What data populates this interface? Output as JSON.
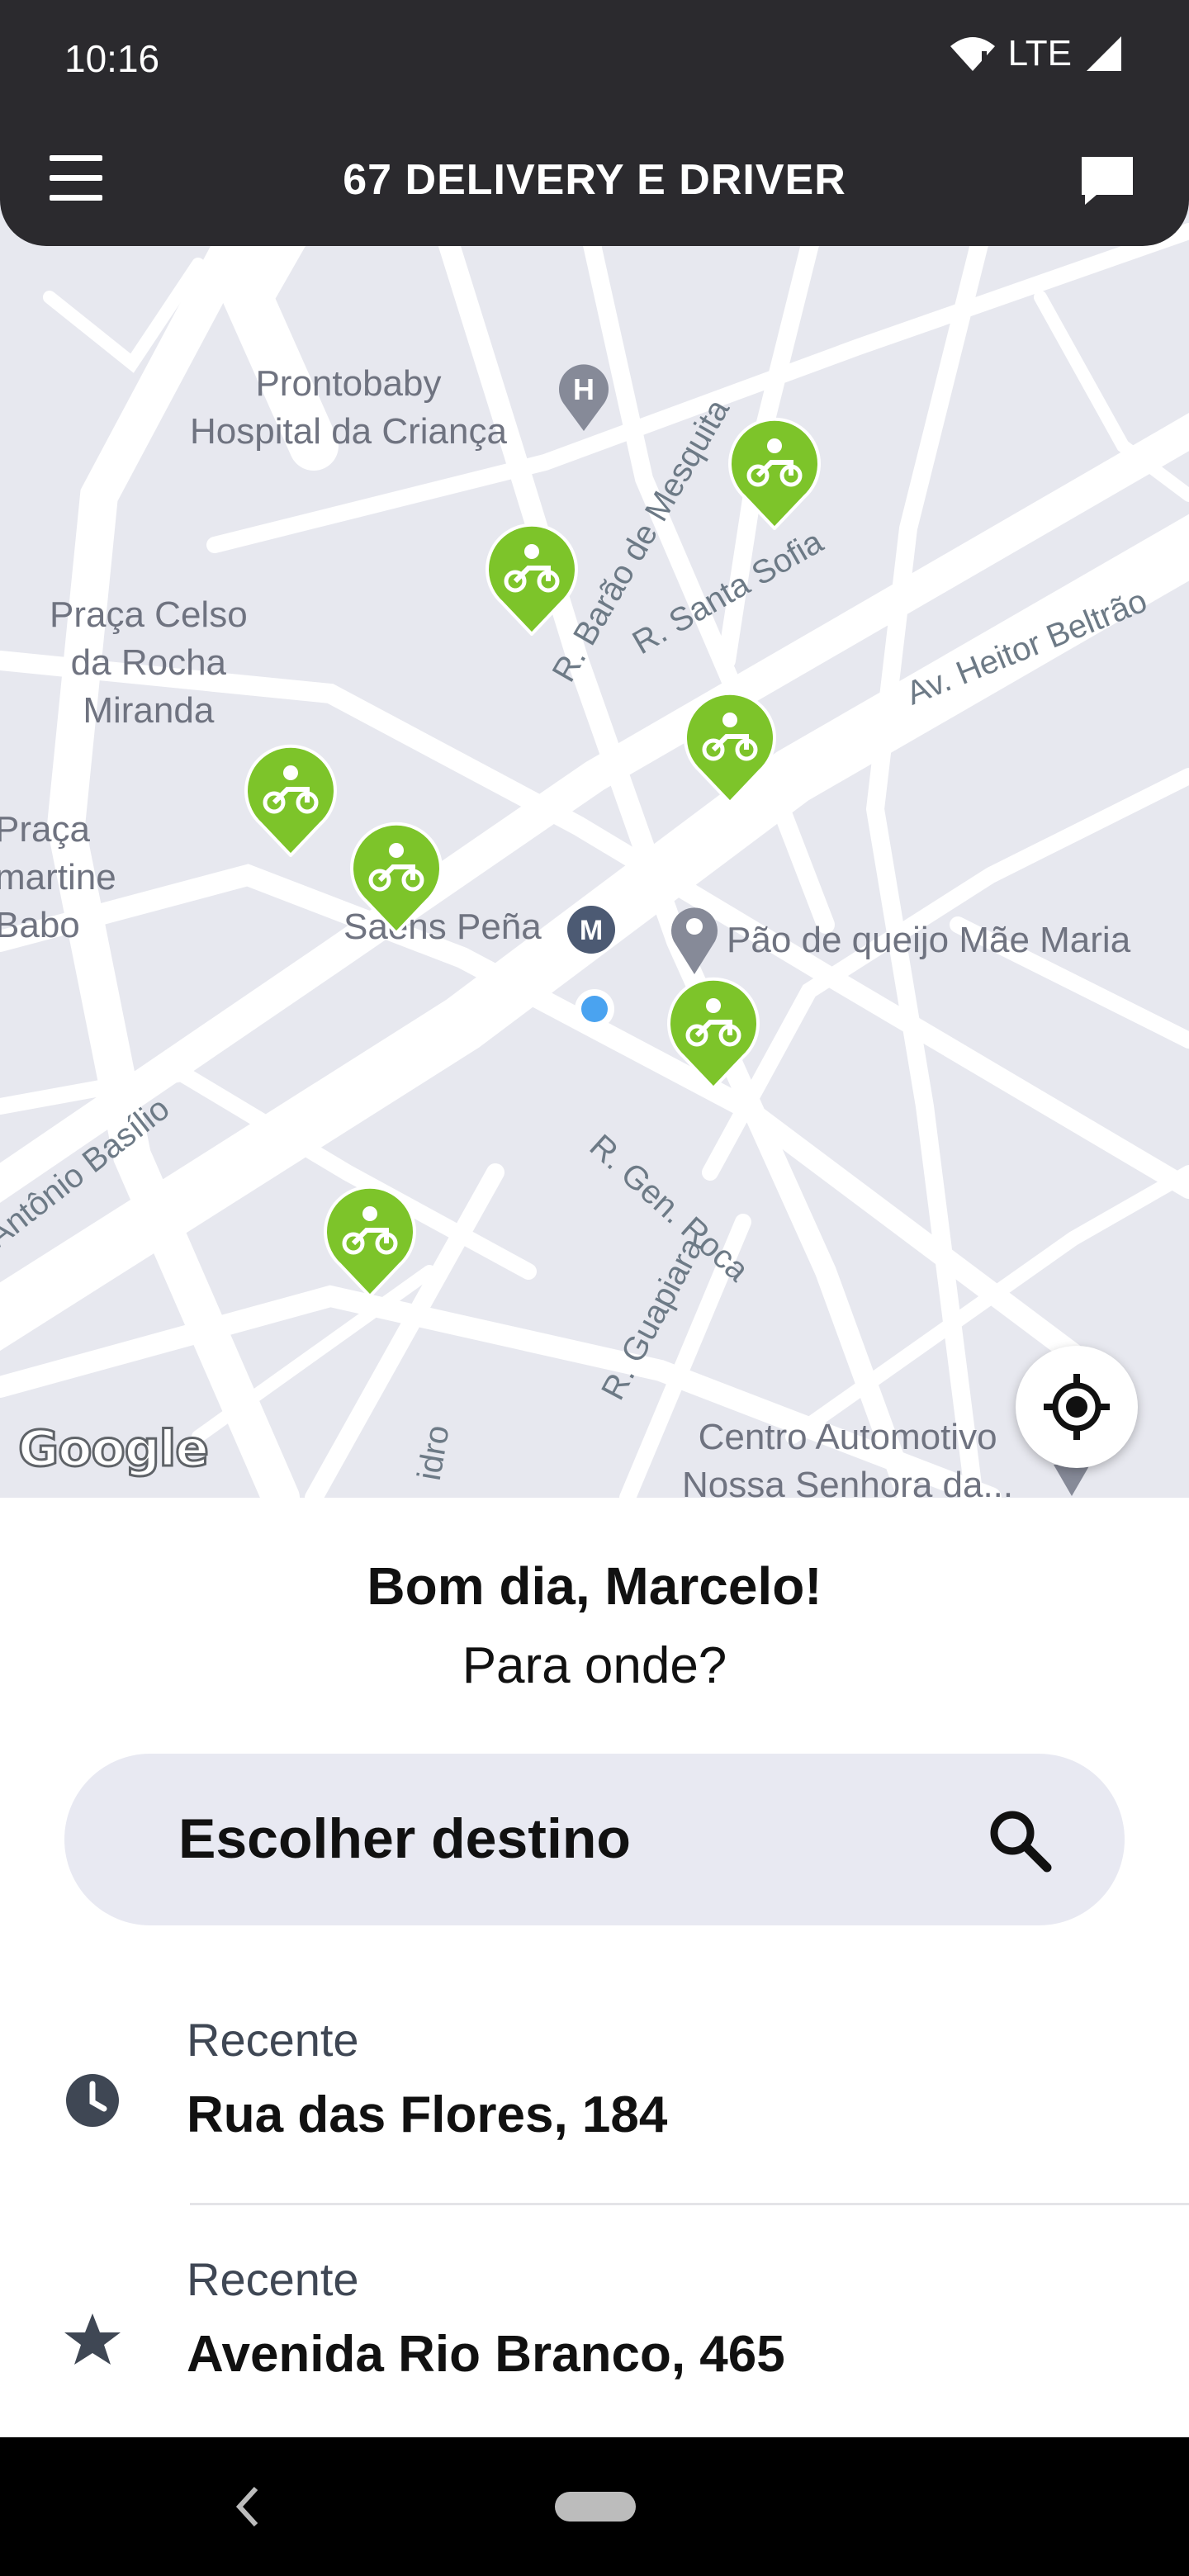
{
  "status": {
    "time": "10:16",
    "network": "LTE"
  },
  "header": {
    "title": "67 DELIVERY E DRIVER"
  },
  "map": {
    "poi": {
      "hospital": "Prontobaby\nHospital da Criança",
      "praca_celso": "Praça Celso\nda Rocha\nMiranda",
      "praca_lamartine": "Praça\nmartine\nBabo",
      "metro": "Saens Peña",
      "shop": "Pão de queijo Mãe Maria",
      "auto": "Centro Automotivo\nNossa Senhora da..."
    },
    "streets": {
      "barao": "R. Barão de Mesquita",
      "santa_sofia": "R. Santa Sofia",
      "heitor": "Av. Heitor Beltrão",
      "antonio": "Antônio Basílio",
      "gen_roca": "R. Gen. Roca",
      "guapiara": "R. Guapiara",
      "idro": "idro"
    },
    "google": "Google"
  },
  "sheet": {
    "greeting": "Bom dia, Marcelo!",
    "prompt": "Para onde?",
    "search_placeholder": "Escolher destino",
    "recents": [
      {
        "kind": "Recente",
        "address": "Rua das Flores, 184",
        "icon": "clock-icon"
      },
      {
        "kind": "Recente",
        "address": "Avenida Rio Branco, 465",
        "icon": "star-icon"
      }
    ]
  },
  "colors": {
    "accent": "#7dc42a",
    "dark": "#2b2a2e",
    "map_bg": "#e7e8ef"
  }
}
